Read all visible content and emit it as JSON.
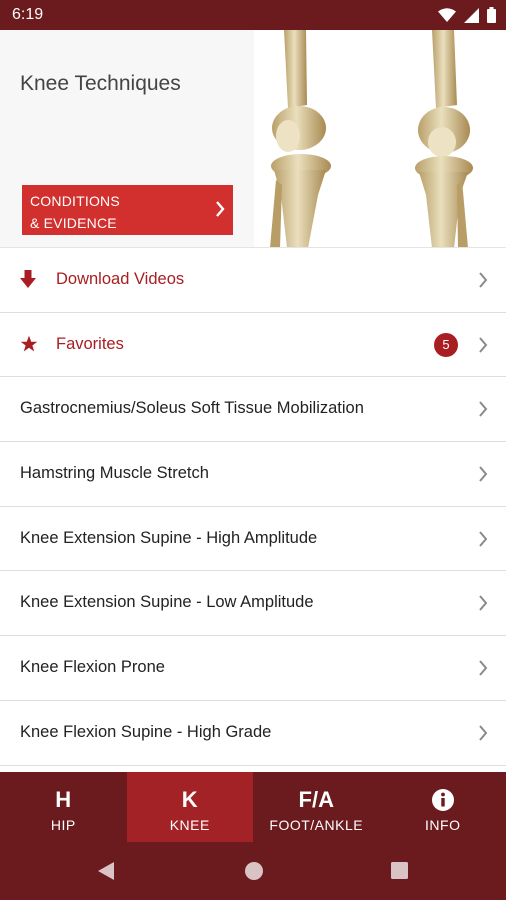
{
  "status": {
    "time": "6:19"
  },
  "hero": {
    "title": "Knee Techniques",
    "cta_line1": "CONDITIONS",
    "cta_line2": "& EVIDENCE"
  },
  "list": {
    "download": "Download Videos",
    "favorites": "Favorites",
    "favorites_count": "5",
    "items": [
      "Gastrocnemius/Soleus Soft Tissue Mobilization",
      "Hamstring Muscle Stretch",
      "Knee Extension Supine - High Amplitude",
      "Knee Extension Supine - Low Amplitude",
      "Knee Flexion Prone",
      "Knee Flexion Supine - High Grade"
    ]
  },
  "tabs": [
    {
      "abbrev": "H",
      "label": "HIP"
    },
    {
      "abbrev": "K",
      "label": "KNEE"
    },
    {
      "abbrev": "F/A",
      "label": "FOOT/ANKLE"
    },
    {
      "abbrev": "",
      "label": "INFO",
      "icon": "info-icon"
    }
  ],
  "active_tab": "KNEE",
  "colors": {
    "brand_dark": "#6b1a1d",
    "active_tab": "#a32226",
    "accent": "#a81e22",
    "cta": "#d22f2f"
  },
  "icons": [
    "wifi-icon",
    "signal-icon",
    "battery-icon",
    "download-arrow-icon",
    "star-icon",
    "chevron-right-icon",
    "info-icon",
    "back-icon",
    "home-icon",
    "recents-icon"
  ]
}
